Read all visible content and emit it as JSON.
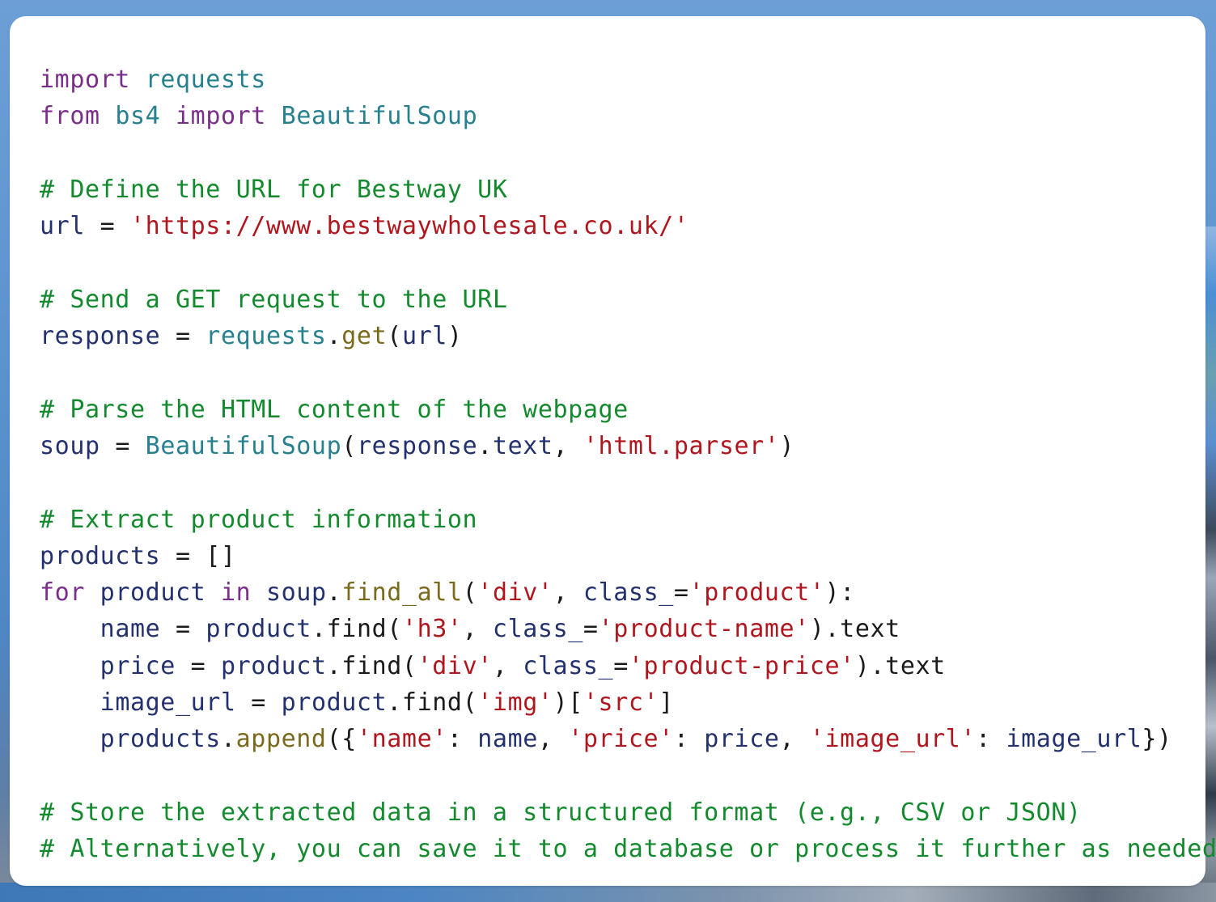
{
  "editor": {
    "language": "python",
    "colors": {
      "keyword": "#7a2e8a",
      "module": "#26808f",
      "comment": "#138a2d",
      "string": "#b0161e",
      "function": "#7a6a1c",
      "identifier": "#23316f",
      "punctuation": "#1a1a1a",
      "background": "#ffffff"
    },
    "lines": [
      [
        {
          "t": "kw",
          "v": "import"
        },
        {
          "t": "pn",
          "v": " "
        },
        {
          "t": "mod",
          "v": "requests"
        }
      ],
      [
        {
          "t": "kw",
          "v": "from"
        },
        {
          "t": "pn",
          "v": " "
        },
        {
          "t": "mod",
          "v": "bs4"
        },
        {
          "t": "pn",
          "v": " "
        },
        {
          "t": "kw",
          "v": "import"
        },
        {
          "t": "pn",
          "v": " "
        },
        {
          "t": "mod",
          "v": "BeautifulSoup"
        }
      ],
      [],
      [
        {
          "t": "cm",
          "v": "# Define the URL for Bestway UK"
        }
      ],
      [
        {
          "t": "var",
          "v": "url"
        },
        {
          "t": "pn",
          "v": " = "
        },
        {
          "t": "str",
          "v": "'https://www.bestwaywholesale.co.uk/'"
        }
      ],
      [],
      [
        {
          "t": "cm",
          "v": "# Send a GET request to the URL"
        }
      ],
      [
        {
          "t": "var",
          "v": "response"
        },
        {
          "t": "pn",
          "v": " = "
        },
        {
          "t": "mod",
          "v": "requests"
        },
        {
          "t": "pn",
          "v": "."
        },
        {
          "t": "fn",
          "v": "get"
        },
        {
          "t": "pn",
          "v": "("
        },
        {
          "t": "var",
          "v": "url"
        },
        {
          "t": "pn",
          "v": ")"
        }
      ],
      [],
      [
        {
          "t": "cm",
          "v": "# Parse the HTML content of the webpage"
        }
      ],
      [
        {
          "t": "var",
          "v": "soup"
        },
        {
          "t": "pn",
          "v": " = "
        },
        {
          "t": "mod",
          "v": "BeautifulSoup"
        },
        {
          "t": "pn",
          "v": "("
        },
        {
          "t": "var",
          "v": "response"
        },
        {
          "t": "pn",
          "v": "."
        },
        {
          "t": "var",
          "v": "text"
        },
        {
          "t": "pn",
          "v": ", "
        },
        {
          "t": "str",
          "v": "'html.parser'"
        },
        {
          "t": "pn",
          "v": ")"
        }
      ],
      [],
      [
        {
          "t": "cm",
          "v": "# Extract product information"
        }
      ],
      [
        {
          "t": "var",
          "v": "products"
        },
        {
          "t": "pn",
          "v": " = []"
        }
      ],
      [
        {
          "t": "kw",
          "v": "for"
        },
        {
          "t": "pn",
          "v": " "
        },
        {
          "t": "var",
          "v": "product"
        },
        {
          "t": "pn",
          "v": " "
        },
        {
          "t": "kw",
          "v": "in"
        },
        {
          "t": "pn",
          "v": " "
        },
        {
          "t": "var",
          "v": "soup"
        },
        {
          "t": "pn",
          "v": "."
        },
        {
          "t": "fn",
          "v": "find_all"
        },
        {
          "t": "pn",
          "v": "("
        },
        {
          "t": "str",
          "v": "'div'"
        },
        {
          "t": "pn",
          "v": ", "
        },
        {
          "t": "var",
          "v": "class_"
        },
        {
          "t": "pn",
          "v": "="
        },
        {
          "t": "str",
          "v": "'product'"
        },
        {
          "t": "pn",
          "v": "):"
        }
      ],
      [
        {
          "t": "pn",
          "v": "    "
        },
        {
          "t": "var",
          "v": "name"
        },
        {
          "t": "pn",
          "v": " = "
        },
        {
          "t": "var",
          "v": "product"
        },
        {
          "t": "pn",
          "v": ".find("
        },
        {
          "t": "str",
          "v": "'h3'"
        },
        {
          "t": "pn",
          "v": ", "
        },
        {
          "t": "var",
          "v": "class_"
        },
        {
          "t": "pn",
          "v": "="
        },
        {
          "t": "str",
          "v": "'product-name'"
        },
        {
          "t": "pn",
          "v": ").text"
        }
      ],
      [
        {
          "t": "pn",
          "v": "    "
        },
        {
          "t": "var",
          "v": "price"
        },
        {
          "t": "pn",
          "v": " = "
        },
        {
          "t": "var",
          "v": "product"
        },
        {
          "t": "pn",
          "v": ".find("
        },
        {
          "t": "str",
          "v": "'div'"
        },
        {
          "t": "pn",
          "v": ", "
        },
        {
          "t": "var",
          "v": "class_"
        },
        {
          "t": "pn",
          "v": "="
        },
        {
          "t": "str",
          "v": "'product-price'"
        },
        {
          "t": "pn",
          "v": ").text"
        }
      ],
      [
        {
          "t": "pn",
          "v": "    "
        },
        {
          "t": "var",
          "v": "image_url"
        },
        {
          "t": "pn",
          "v": " = "
        },
        {
          "t": "var",
          "v": "product"
        },
        {
          "t": "pn",
          "v": ".find("
        },
        {
          "t": "str",
          "v": "'img'"
        },
        {
          "t": "pn",
          "v": ")["
        },
        {
          "t": "str",
          "v": "'src'"
        },
        {
          "t": "pn",
          "v": "]"
        }
      ],
      [
        {
          "t": "pn",
          "v": "    "
        },
        {
          "t": "var",
          "v": "products"
        },
        {
          "t": "pn",
          "v": "."
        },
        {
          "t": "fn",
          "v": "append"
        },
        {
          "t": "pn",
          "v": "({"
        },
        {
          "t": "str",
          "v": "'name'"
        },
        {
          "t": "pn",
          "v": ": "
        },
        {
          "t": "var",
          "v": "name"
        },
        {
          "t": "pn",
          "v": ", "
        },
        {
          "t": "str",
          "v": "'price'"
        },
        {
          "t": "pn",
          "v": ": "
        },
        {
          "t": "var",
          "v": "price"
        },
        {
          "t": "pn",
          "v": ", "
        },
        {
          "t": "str",
          "v": "'image_url'"
        },
        {
          "t": "pn",
          "v": ": "
        },
        {
          "t": "var",
          "v": "image_url"
        },
        {
          "t": "pn",
          "v": "})"
        }
      ],
      [],
      [
        {
          "t": "cm",
          "v": "# Store the extracted data in a structured format (e.g., CSV or JSON)"
        }
      ],
      [
        {
          "t": "cm",
          "v": "# Alternatively, you can save it to a database or process it further as needed"
        }
      ]
    ]
  }
}
